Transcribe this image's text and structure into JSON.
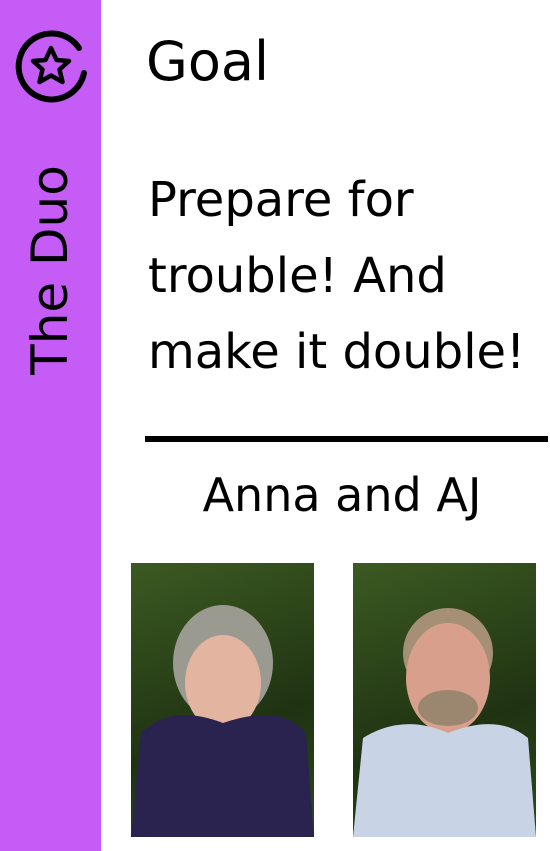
{
  "sidebar": {
    "title": "The Duo",
    "icon": "star-circle-icon",
    "color": "#c55cf6"
  },
  "goal": {
    "label": "Goal",
    "text": "Prepare for trouble! And make it double!"
  },
  "team": {
    "names": "Anna and AJ"
  }
}
